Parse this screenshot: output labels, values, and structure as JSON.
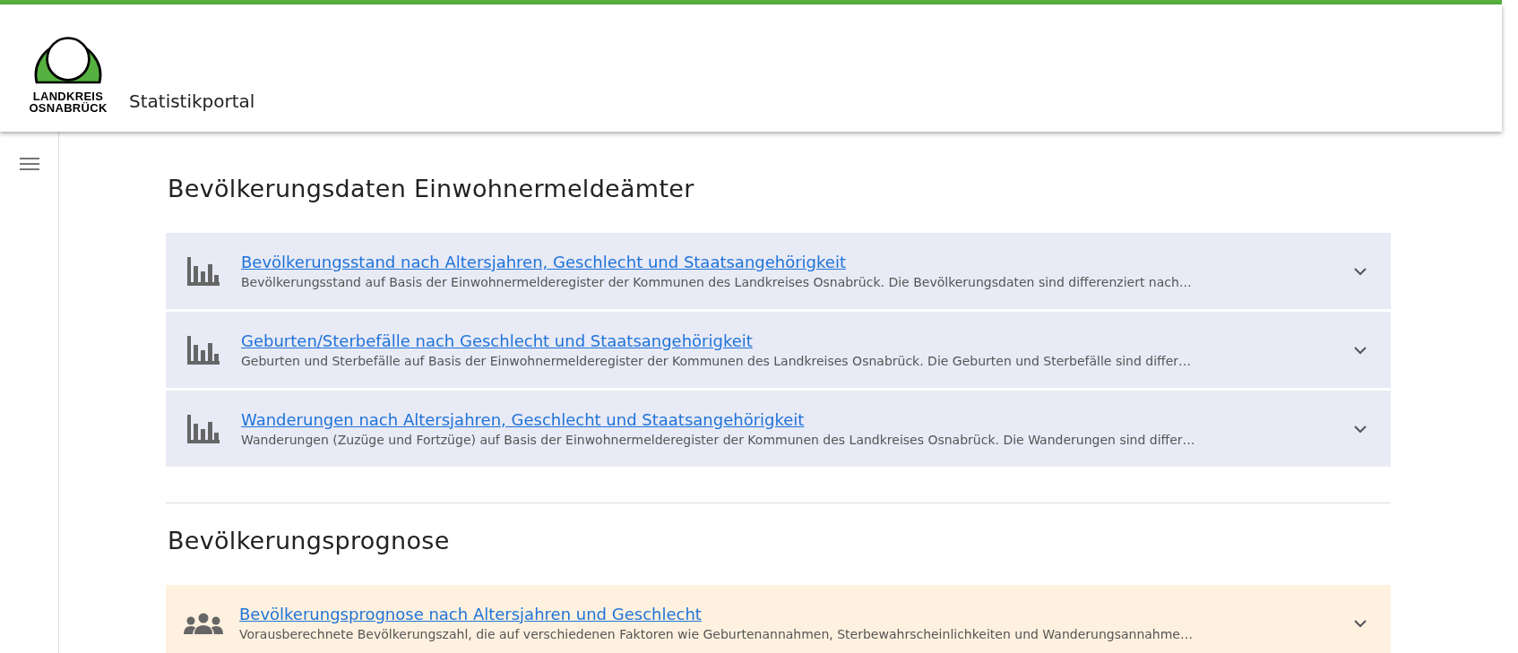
{
  "header": {
    "logo_lines": [
      "LANDKREIS",
      "OSNABRÜCK"
    ],
    "title": "Statistikportal"
  },
  "sections": [
    {
      "title": "Bevölkerungsdaten Einwohnermeldeämter",
      "items": [
        {
          "kind": "chart",
          "title": "Bevölkerungsstand nach Altersjahren, Geschlecht und Staatsangehörigkeit",
          "description": "Bevölkerungsstand auf Basis der Einwohnermelderegister der Kommunen des Landkreises Osnabrück. Die Bevölkerungsdaten sind differenziert nach…",
          "expanded": false
        },
        {
          "kind": "chart",
          "title": "Geburten/Sterbefälle nach Geschlecht und Staatsangehörigkeit",
          "description": "Geburten und Sterbefälle auf Basis der Einwohnermelderegister der Kommunen des Landkreises Osnabrück. Die Geburten und Sterbefälle sind differ…",
          "expanded": false
        },
        {
          "kind": "chart",
          "title": "Wanderungen nach Altersjahren, Geschlecht und Staatsangehörigkeit",
          "description": "Wanderungen (Zuzüge und Fortzüge) auf Basis der Einwohnermelderegister der Kommunen des Landkreises Osnabrück. Die Wanderungen sind differ…",
          "expanded": false
        }
      ]
    },
    {
      "title": "Bevölkerungsprognose",
      "items": [
        {
          "kind": "people",
          "title": "Bevölkerungsprognose nach Altersjahren und Geschlecht",
          "description": "Vorausberechnete Bevölkerungszahl, die auf verschiedenen Faktoren wie Geburtenannahmen, Sterbewahrscheinlichkeiten und Wanderungsannahme…",
          "expanded": false
        }
      ]
    }
  ]
}
